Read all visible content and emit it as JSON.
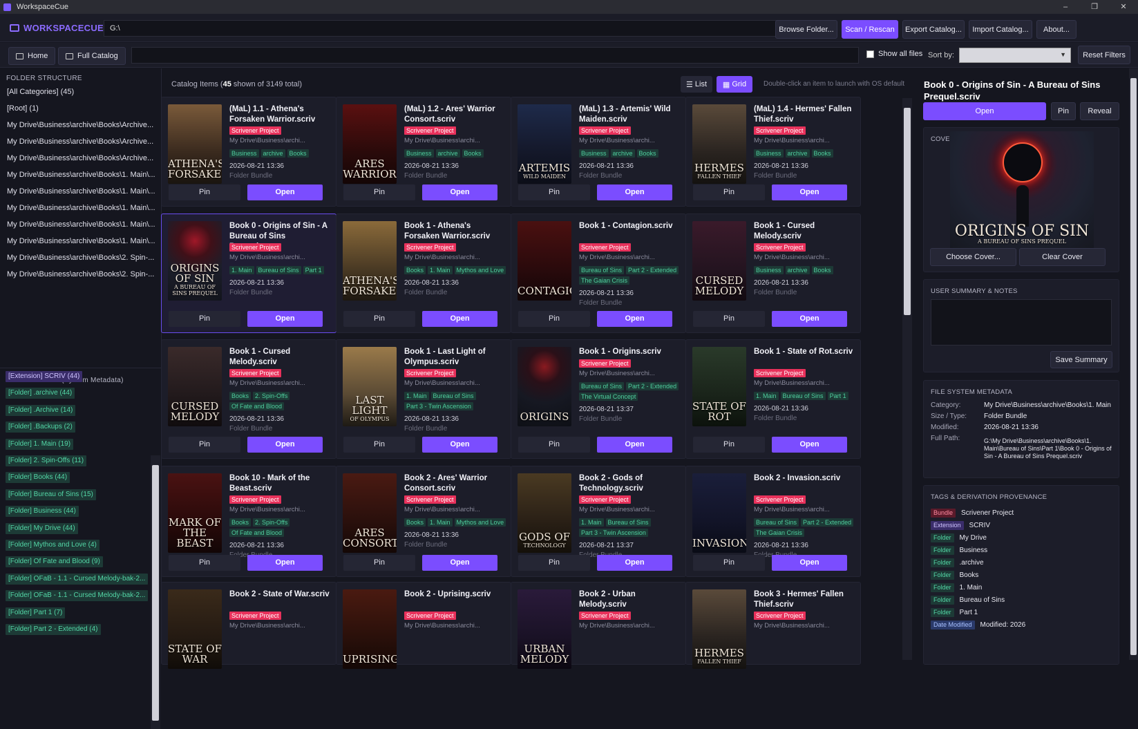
{
  "window": {
    "title": "WorkspaceCue",
    "minimize": "–",
    "maximize": "❐",
    "close": "✕"
  },
  "brand": "WORKSPACECUE",
  "path_value": "G:\\",
  "toolbar": {
    "browse": "Browse Folder...",
    "scan": "Scan / Rescan",
    "export": "Export Catalog...",
    "import": "Import Catalog...",
    "about": "About..."
  },
  "nav": {
    "home": "Home",
    "full_catalog": "Full Catalog",
    "show_all": "Show all files",
    "sort_by": "Sort by:",
    "sort_value": "",
    "reset": "Reset Filters"
  },
  "sidebar": {
    "folder_title": "FOLDER STRUCTURE",
    "folders": [
      "[All Categories] (45)",
      "[Root] (1)",
      "My Drive\\Business\\archive\\Books\\Archive...",
      "My Drive\\Business\\archive\\Books\\Archive...",
      "My Drive\\Business\\archive\\Books\\Archive...",
      "My Drive\\Business\\archive\\Books\\1. Main\\...",
      "My Drive\\Business\\archive\\Books\\1. Main\\...",
      "My Drive\\Business\\archive\\Books\\1. Main\\...",
      "My Drive\\Business\\archive\\Books\\1. Main\\...",
      "My Drive\\Business\\archive\\Books\\1. Main\\...",
      "My Drive\\Business\\archive\\Books\\2. Spin-...",
      "My Drive\\Business\\archive\\Books\\2. Spin-..."
    ],
    "tags_title": "DERIVED TAGS (System Metadata)",
    "tags": [
      "[Extension] SCRIV (44)",
      "[Folder] .archive (44)",
      "[Folder] .Archive (14)",
      "[Folder] .Backups (2)",
      "[Folder] 1. Main (19)",
      "[Folder] 2. Spin-Offs (11)",
      "[Folder] Books (44)",
      "[Folder] Bureau of Sins (15)",
      "[Folder] Business (44)",
      "[Folder] My Drive (44)",
      "[Folder] Mythos and Love (4)",
      "[Folder] Of Fate and Blood (9)",
      "[Folder] OFaB - 1.1 - Cursed Melody-bak-2...",
      "[Folder] OFaB - 1.1 - Cursed Melody-bak-2...",
      "[Folder] Part 1 (7)",
      "[Folder] Part 2 - Extended (4)"
    ]
  },
  "catalog": {
    "label_pre": "Catalog Items (",
    "shown": "45",
    "label_mid": "shown of",
    "total": "3149",
    "label_post": "total)",
    "list": "List",
    "grid": "Grid",
    "hint": "Double-click an item to launch with OS default"
  },
  "card_common": {
    "badge": "Scrivener Project",
    "path": "My Drive\\Business\\archi...",
    "kind": "Folder Bundle",
    "pin": "Pin",
    "open": "Open"
  },
  "cards": [
    {
      "title": "(MaL) 1.1 - Athena's Forsaken Warrior.scriv",
      "tags": [
        "Business",
        "archive",
        "Books"
      ],
      "date": "2026-08-21 13:36",
      "cover": "ATHENA'S FORSAKEN",
      "cover_sub": ""
    },
    {
      "title": "(MaL) 1.2 - Ares' Warrior Consort.scriv",
      "tags": [
        "Business",
        "archive",
        "Books"
      ],
      "date": "2026-08-21 13:36",
      "cover": "ARES WARRIOR",
      "cover_sub": ""
    },
    {
      "title": "(MaL) 1.3 - Artemis' Wild Maiden.scriv",
      "tags": [
        "Business",
        "archive",
        "Books"
      ],
      "date": "2026-08-21 13:36",
      "cover": "ARTEMIS",
      "cover_sub": "WILD MAIDEN"
    },
    {
      "title": "(MaL) 1.4 - Hermes' Fallen Thief.scriv",
      "tags": [
        "Business",
        "archive",
        "Books"
      ],
      "date": "2026-08-21 13:36",
      "cover": "HERMES",
      "cover_sub": "FALLEN THIEF"
    },
    {
      "title": "Book 0 - Origins of Sin - A Bureau of Sins Prequel.sc...",
      "tags": [
        "1. Main",
        "Bureau of Sins",
        "Part 1"
      ],
      "date": "2026-08-21 13:36",
      "cover": "ORIGINS OF SIN",
      "cover_sub": "A BUREAU OF SINS PREQUEL"
    },
    {
      "title": "Book 1 - Athena's Forsaken Warrior.scriv",
      "tags": [
        "Books",
        "1. Main",
        "Mythos and Love"
      ],
      "date": "2026-08-21 13:36",
      "cover": "ATHENA'S FORSAKEN",
      "cover_sub": ""
    },
    {
      "title": "Book 1 - Contagion.scriv",
      "tags": [
        "Bureau of Sins",
        "Part 2 - Extended",
        "The Gaian Crisis"
      ],
      "date": "2026-08-21 13:36",
      "cover": "CONTAGION",
      "cover_sub": ""
    },
    {
      "title": "Book 1 - Cursed Melody.scriv",
      "tags": [
        "Business",
        "archive",
        "Books"
      ],
      "date": "2026-08-21 13:36",
      "cover": "CURSED MELODY",
      "cover_sub": ""
    },
    {
      "title": "Book 1 - Cursed Melody.scriv",
      "tags": [
        "Books",
        "2. Spin-Offs",
        "Of Fate and Blood"
      ],
      "date": "2026-08-21 13:36",
      "cover": "CURSED MELODY",
      "cover_sub": ""
    },
    {
      "title": "Book 1 - Last Light of Olympus.scriv",
      "tags": [
        "1. Main",
        "Bureau of Sins",
        "Part 3 - Twin Ascension"
      ],
      "date": "2026-08-21 13:36",
      "cover": "LAST LIGHT",
      "cover_sub": "OF OLYMPUS"
    },
    {
      "title": "Book 1 - Origins.scriv",
      "tags": [
        "Bureau of Sins",
        "Part 2 - Extended",
        "The Virtual Concept"
      ],
      "date": "2026-08-21 13:37",
      "cover": "ORIGINS",
      "cover_sub": ""
    },
    {
      "title": "Book 1 - State of Rot.scriv",
      "tags": [
        "1. Main",
        "Bureau of Sins",
        "Part 1"
      ],
      "date": "2026-08-21 13:36",
      "cover": "STATE OF ROT",
      "cover_sub": ""
    },
    {
      "title": "Book 10 - Mark of the Beast.scriv",
      "tags": [
        "Books",
        "2. Spin-Offs",
        "Of Fate and Blood"
      ],
      "date": "2026-08-21 13:36",
      "cover": "MARK OF THE BEAST",
      "cover_sub": ""
    },
    {
      "title": "Book 2 - Ares' Warrior Consort.scriv",
      "tags": [
        "Books",
        "1. Main",
        "Mythos and Love"
      ],
      "date": "2026-08-21 13:36",
      "cover": "ARES CONSORT",
      "cover_sub": ""
    },
    {
      "title": "Book 2 - Gods of Technology.scriv",
      "tags": [
        "1. Main",
        "Bureau of Sins",
        "Part 3 - Twin Ascension"
      ],
      "date": "2026-08-21 13:37",
      "cover": "GODS OF",
      "cover_sub": "TECHNOLOGY"
    },
    {
      "title": "Book 2 - Invasion.scriv",
      "tags": [
        "Bureau of Sins",
        "Part 2 - Extended",
        "The Gaian Crisis"
      ],
      "date": "2026-08-21 13:36",
      "cover": "INVASION",
      "cover_sub": ""
    },
    {
      "title": "Book 2 - State of War.scriv",
      "tags": [],
      "date": "",
      "cover": "STATE OF WAR",
      "cover_sub": ""
    },
    {
      "title": "Book 2 - Uprising.scriv",
      "tags": [],
      "date": "",
      "cover": "UPRISING",
      "cover_sub": ""
    },
    {
      "title": "Book 2 - Urban Melody.scriv",
      "tags": [],
      "date": "",
      "cover": "URBAN MELODY",
      "cover_sub": ""
    },
    {
      "title": "Book 3 - Hermes' Fallen Thief.scriv",
      "tags": [],
      "date": "",
      "cover": "HERMES",
      "cover_sub": "FALLEN THIEF"
    }
  ],
  "detail": {
    "title": "Book 0 - Origins of Sin - A Bureau of Sins Prequel.scriv",
    "open": "Open",
    "pin": "Pin",
    "reveal": "Reveal",
    "cover_label": "COVER IMAGE",
    "cover_text": "ORIGINS OF SIN",
    "cover_sub": "A BUREAU OF SINS PREQUEL",
    "choose_cover": "Choose Cover...",
    "clear_cover": "Clear Cover",
    "notes_label": "USER SUMMARY & NOTES",
    "save_summary": "Save Summary",
    "meta_label": "FILE SYSTEM METADATA",
    "meta": [
      {
        "k": "Category:",
        "v": "My Drive\\Business\\archive\\Books\\1. Main"
      },
      {
        "k": "Size / Type:",
        "v": "Folder Bundle"
      },
      {
        "k": "Modified:",
        "v": "2026-08-21 13:36"
      },
      {
        "k": "Full Path:",
        "v": "G:\\My Drive\\Business\\archive\\Books\\1. Main\\Bureau of Sins\\Part 1\\Book 0 - Origins of Sin - A Bureau of Sins Prequel.scriv"
      }
    ],
    "prov_label": "TAGS & DERIVATION PROVENANCE",
    "prov": [
      {
        "k": "Bundle",
        "v": "Scrivener Project",
        "kind": "bundle"
      },
      {
        "k": "Extension",
        "v": "SCRIV",
        "kind": "ext"
      },
      {
        "k": "Folder",
        "v": "My Drive",
        "kind": "folder"
      },
      {
        "k": "Folder",
        "v": "Business",
        "kind": "folder"
      },
      {
        "k": "Folder",
        "v": ".archive",
        "kind": "folder"
      },
      {
        "k": "Folder",
        "v": "Books",
        "kind": "folder"
      },
      {
        "k": "Folder",
        "v": "1. Main",
        "kind": "folder"
      },
      {
        "k": "Folder",
        "v": "Bureau of Sins",
        "kind": "folder"
      },
      {
        "k": "Folder",
        "v": "Part 1",
        "kind": "folder"
      },
      {
        "k": "Date Modified",
        "v": "Modified: 2026",
        "kind": "date"
      }
    ]
  },
  "colors": {
    "accent": "#7b4dff",
    "badge": "#e8315b",
    "tag_bg": "#1d3a36",
    "tag_fg": "#4fcf9e"
  }
}
